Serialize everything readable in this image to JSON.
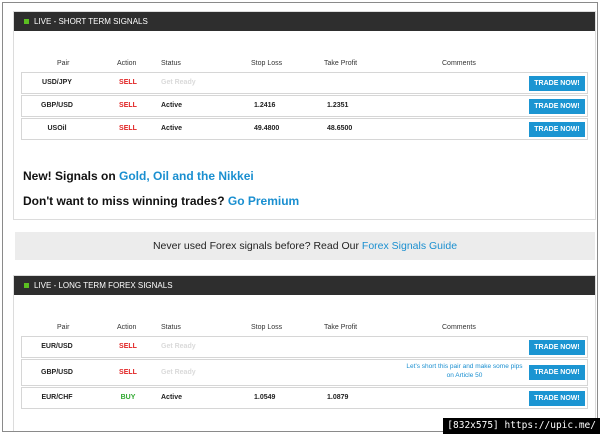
{
  "short_term": {
    "title": "LIVE - SHORT TERM SIGNALS",
    "columns": {
      "pair": "Pair",
      "action": "Action",
      "status": "Status",
      "stop_loss": "Stop Loss",
      "take_profit": "Take Profit",
      "comments": "Comments"
    },
    "rows": [
      {
        "pair": "USD/JPY",
        "action": "SELL",
        "status": "Get Ready",
        "stop_loss": "",
        "take_profit": "",
        "comment": "",
        "button": "TRADE NOW!"
      },
      {
        "pair": "GBP/USD",
        "action": "SELL",
        "status": "Active",
        "stop_loss": "1.2416",
        "take_profit": "1.2351",
        "comment": "",
        "button": "TRADE NOW!"
      },
      {
        "pair": "USOil",
        "action": "SELL",
        "status": "Active",
        "stop_loss": "49.4800",
        "take_profit": "48.6500",
        "comment": "",
        "button": "TRADE NOW!"
      }
    ]
  },
  "promo": {
    "line1_prefix": "New! Signals on ",
    "line1_link": "Gold, Oil and the Nikkei",
    "line2_prefix": "Don't want to miss winning trades? ",
    "line2_link": "Go Premium"
  },
  "guide": {
    "prefix": "Never used Forex signals before? Read Our ",
    "link": "Forex Signals Guide"
  },
  "long_term": {
    "title": "LIVE - LONG TERM FOREX SIGNALS",
    "columns": {
      "pair": "Pair",
      "action": "Action",
      "status": "Status",
      "stop_loss": "Stop Loss",
      "take_profit": "Take Profit",
      "comments": "Comments"
    },
    "rows": [
      {
        "pair": "EUR/USD",
        "action": "SELL",
        "status": "Get Ready",
        "stop_loss": "",
        "take_profit": "",
        "comment": "",
        "button": "TRADE NOW!"
      },
      {
        "pair": "GBP/USD",
        "action": "SELL",
        "status": "Get Ready",
        "stop_loss": "",
        "take_profit": "",
        "comment": "Let's short this pair and make some pips on Article 50",
        "button": "TRADE NOW!"
      },
      {
        "pair": "EUR/CHF",
        "action": "BUY",
        "status": "Active",
        "stop_loss": "1.0549",
        "take_profit": "1.0879",
        "comment": "",
        "button": "TRADE NOW!"
      }
    ]
  },
  "watermark": "[832x575] https://upic.me/",
  "colors": {
    "header_bg": "#2e2e2e",
    "live_icon": "#5bbf21",
    "sell": "#e02020",
    "buy": "#2fa82f",
    "link": "#1a8fd0",
    "button": "#1b95d2"
  }
}
